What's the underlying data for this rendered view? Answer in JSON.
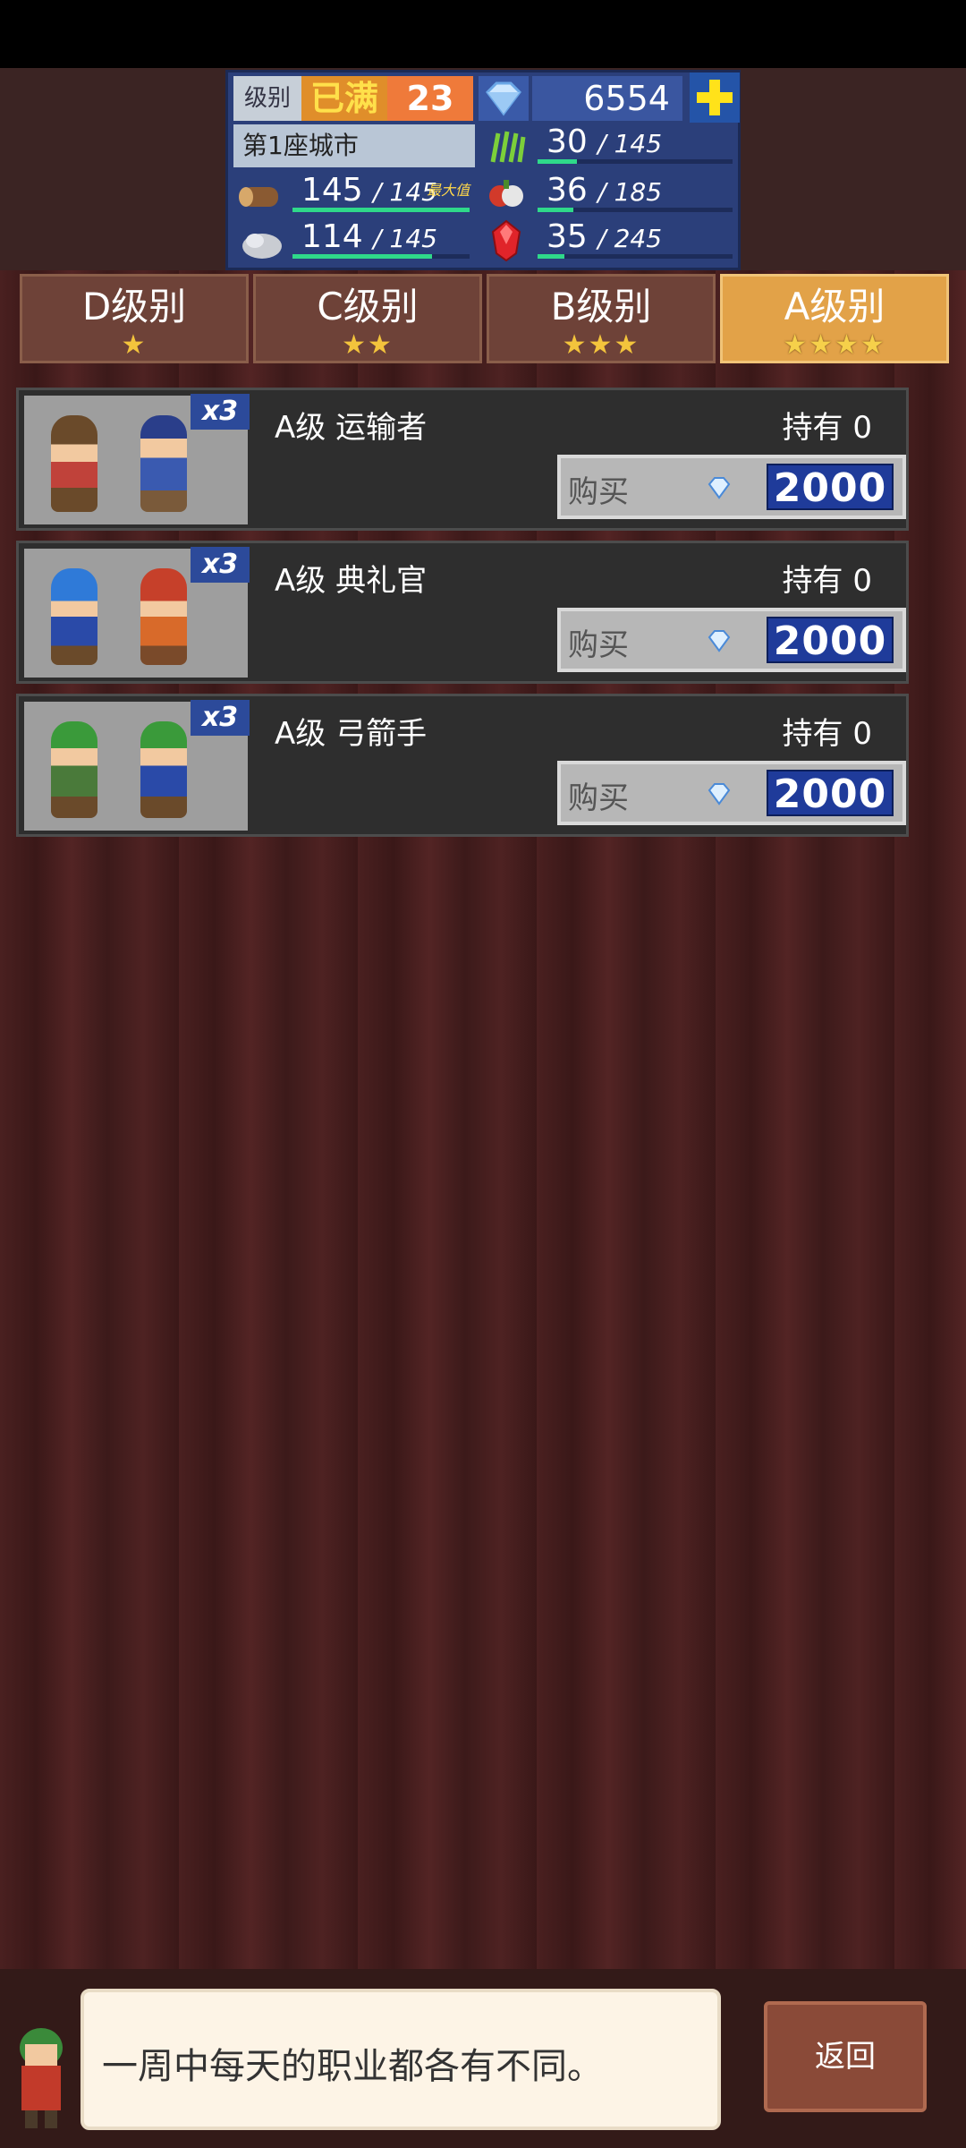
{
  "hud": {
    "level_label": "级别",
    "level_status": "已满",
    "level_value": "23",
    "gems": "6554",
    "city_name": "第1座城市",
    "resources": [
      {
        "icon": "wood-log-icon",
        "value": "145",
        "cap": "/ 145",
        "tag": "最大值",
        "fill": 1.0
      },
      {
        "icon": "grass-icon",
        "value": "30",
        "cap": "/ 145",
        "fill": 0.21
      },
      {
        "icon": "stone-icon",
        "value": "114",
        "cap": "/ 145",
        "fill": 0.79
      },
      {
        "icon": "food-icon",
        "value": "36",
        "cap": "/ 185",
        "fill": 0.19
      },
      {
        "icon": "red-gem-icon",
        "value": "35",
        "cap": "/ 245",
        "fill": 0.14
      }
    ]
  },
  "tabs": [
    {
      "label": "D级别",
      "stars": "★"
    },
    {
      "label": "C级别",
      "stars": "★★"
    },
    {
      "label": "B级别",
      "stars": "★★★"
    },
    {
      "label": "A级别",
      "stars": "★★★★"
    }
  ],
  "items": [
    {
      "name": "A级 运输者",
      "owned": "持有 0",
      "buy": "购买",
      "price": "2000",
      "multiplier": "x3"
    },
    {
      "name": "A级 典礼官",
      "owned": "持有 0",
      "buy": "购买",
      "price": "2000",
      "multiplier": "x3"
    },
    {
      "name": "A级 弓箭手",
      "owned": "持有 0",
      "buy": "购买",
      "price": "2000",
      "multiplier": "x3"
    }
  ],
  "bubble_text": "一周中每天的职业都各有不同。",
  "back_label": "返回",
  "colors": {
    "active_tab": "#e2a248",
    "price_bg": "#1f3b9a",
    "hud_bg": "#2b3f7a"
  }
}
